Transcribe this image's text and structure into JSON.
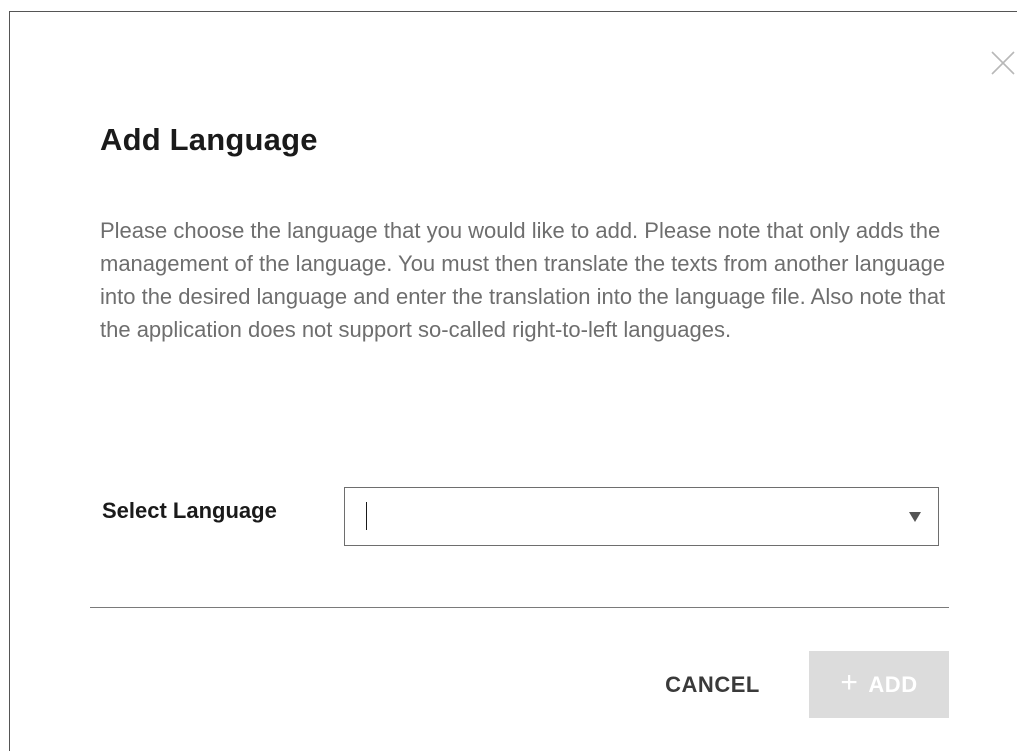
{
  "dialog": {
    "title": "Add Language",
    "description": "Please choose the language that you would like to add. Please note that only adds the management of the language. You must then translate the texts from another language into the desired language and enter the translation into the language file. Also note that the application does not support so-called right-to-left languages.",
    "close_icon": "close-icon"
  },
  "form": {
    "select_label": "Select Language",
    "select_value": "",
    "select_placeholder": "",
    "dropdown_icon": "triangle-down-icon"
  },
  "actions": {
    "cancel_label": "CANCEL",
    "add_label": "ADD",
    "add_icon": "plus-icon",
    "add_disabled": true
  },
  "colors": {
    "title": "#1a1a1a",
    "description": "#6e6e6e",
    "add_button_bg_disabled": "#dcdcdc",
    "add_button_text": "#ffffff",
    "divider": "#7a7a7a"
  }
}
